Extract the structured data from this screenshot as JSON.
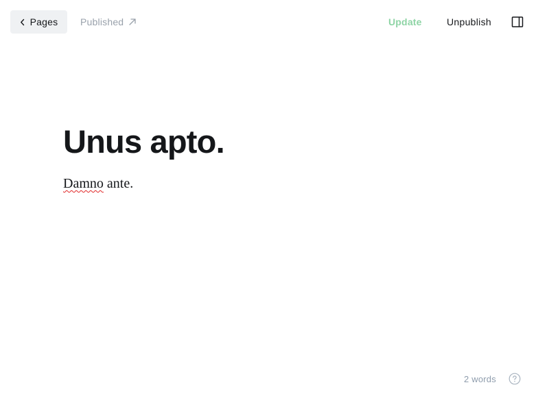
{
  "header": {
    "back_label": "Pages",
    "status_label": "Published",
    "update_label": "Update",
    "unpublish_label": "Unpublish",
    "icons": {
      "back": "chevron-left-icon",
      "status": "external-link-arrow-icon",
      "sidebar": "sidebar-panel-icon"
    }
  },
  "editor": {
    "title": "Unus apto.",
    "body_parts": [
      "Damno",
      " ante."
    ],
    "misspelled_word": "Damno"
  },
  "footer": {
    "word_count": "2 words",
    "help_icon": "question-circle-icon"
  },
  "colors": {
    "update_accent": "#8ed4a5",
    "muted_text": "#99a1ab",
    "button_bg": "#eff1f3",
    "spellcheck": "#e02424"
  }
}
